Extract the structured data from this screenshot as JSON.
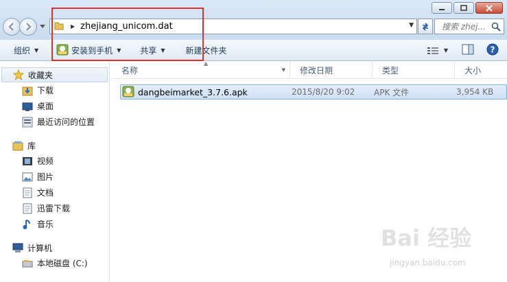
{
  "window": {
    "minimize": "minimize",
    "maximize": "maximize",
    "close": "close"
  },
  "address": {
    "path": "zhejiang_unicom.dat"
  },
  "search": {
    "placeholder": "搜索 zhej..."
  },
  "toolbar": {
    "organize": "组织",
    "install": "安装到手机",
    "share": "共享",
    "new_folder": "新建文件夹"
  },
  "nav": {
    "favorites": "收藏夹",
    "fav_items": [
      "下载",
      "桌面",
      "最近访问的位置"
    ],
    "libraries": "库",
    "lib_items": [
      "视频",
      "图片",
      "文档",
      "迅雷下载",
      "音乐"
    ],
    "computer": "计算机",
    "computer_items": [
      "本地磁盘 (C:)"
    ]
  },
  "columns": {
    "name": "名称",
    "date": "修改日期",
    "type": "类型",
    "size": "大小"
  },
  "files": [
    {
      "name": "dangbeimarket_3.7.6.apk",
      "date": "2015/8/20 9:02",
      "type": "APK 文件",
      "size": "3,954 KB"
    }
  ],
  "watermark": {
    "text": "Bai 经验",
    "sub": "jingyan.baidu.com"
  },
  "colors": {
    "highlight_box": "#e0322d",
    "selection": "#cfe0f6"
  }
}
